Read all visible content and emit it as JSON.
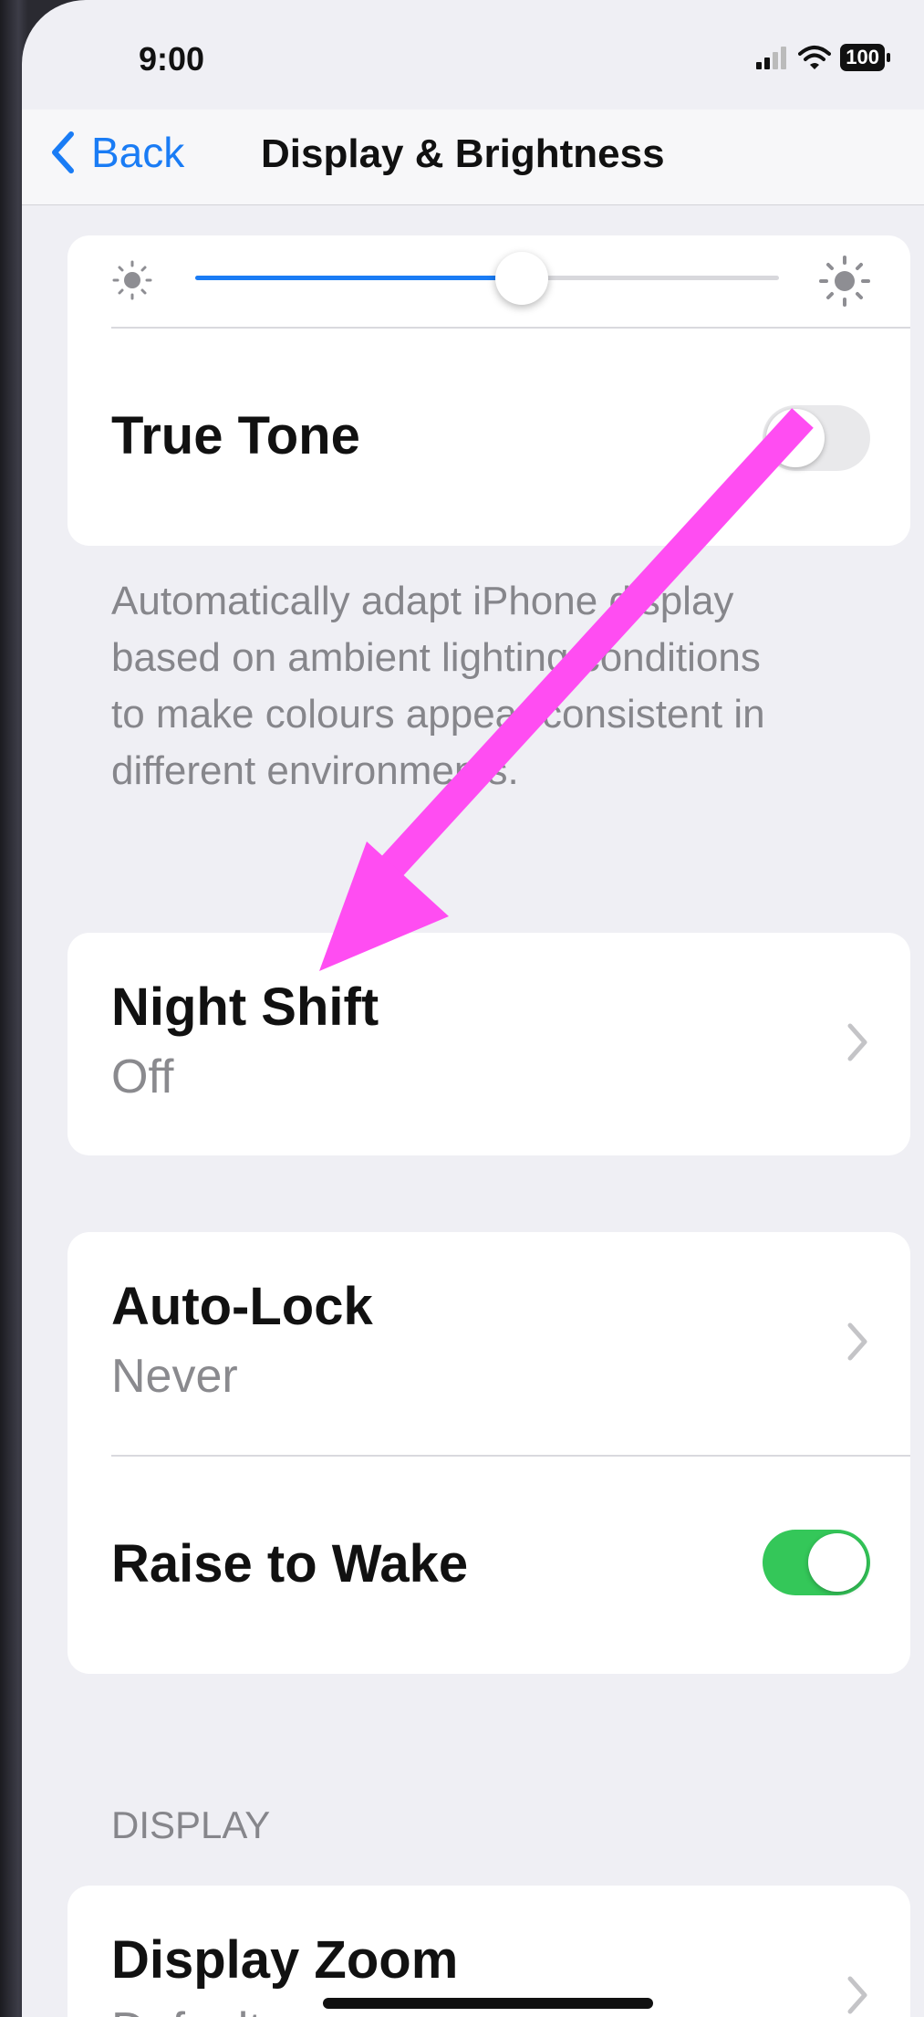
{
  "status_bar": {
    "time": "9:00",
    "battery": "100",
    "icons": [
      "signal-icon",
      "wifi-icon",
      "battery-icon"
    ]
  },
  "nav": {
    "back_label": "Back",
    "title": "Display & Brightness"
  },
  "brightness": {
    "level": 0.56
  },
  "true_tone": {
    "label": "True Tone",
    "enabled": false,
    "footer": "Automatically adapt iPhone display based on ambient lighting conditions to make colours appear consistent in different environments."
  },
  "night_shift": {
    "label": "Night Shift",
    "value": "Off"
  },
  "auto_lock": {
    "label": "Auto-Lock",
    "value": "Never"
  },
  "raise_to_wake": {
    "label": "Raise to Wake",
    "enabled": true
  },
  "display_section": {
    "header": "DISPLAY",
    "zoom_label": "Display Zoom",
    "zoom_value": "Default"
  },
  "annotation": {
    "color": "#ff4df2"
  },
  "colors": {
    "accent": "#1a7cf5",
    "toggle_on": "#34c759",
    "toggle_off": "#e9e9eb"
  }
}
